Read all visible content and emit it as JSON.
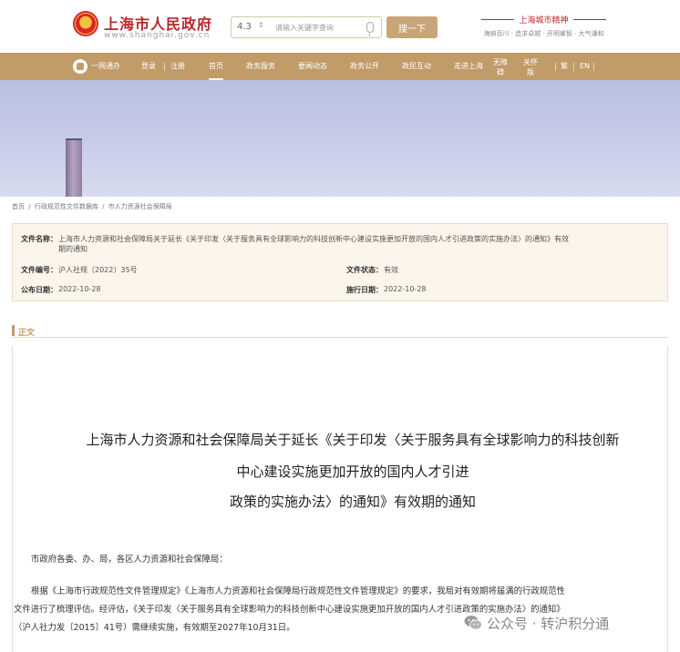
{
  "header": {
    "site_title": "上海市人民政府",
    "site_url": "www.shanghai.gov.cn",
    "search": {
      "scope": "4.3",
      "placeholder": "请输入关键字查询",
      "button_label": "搜一下"
    },
    "city_spirit": {
      "title": "上海城市精神",
      "text": "海纳百川 · 追求卓越 · 开明睿智 · 大气谦和"
    }
  },
  "nav": {
    "items": [
      {
        "label": "一网通办"
      },
      {
        "label": "登录"
      },
      {
        "label": "注册"
      },
      {
        "label": "首页"
      },
      {
        "label": "政务服务"
      },
      {
        "label": "要闻动态"
      },
      {
        "label": "政务公开"
      },
      {
        "label": "政民互动"
      },
      {
        "label": "走进上海"
      },
      {
        "label": "无障碍"
      },
      {
        "label": "关怀版"
      },
      {
        "label": "繁"
      },
      {
        "label": "EN"
      }
    ]
  },
  "breadcrumb": [
    "首页",
    "/",
    "行政规范性文件数据库",
    "/",
    "市人力资源社会保障局"
  ],
  "info": {
    "doc_name_label": "文件名称：",
    "doc_name": "上海市人力资源和社会保障局关于延长《关于印发〈关于服务具有全球影响力的科技创新中心建设实施更加开放的国内人才引进政策的实施办法〉的通知》有效期的通知",
    "doc_no_label": "文件编号：",
    "doc_no": "沪人社规〔2022〕35号",
    "status_label": "文件状态：",
    "status": "有效",
    "publish_label": "公布日期：",
    "publish_date": "2022-10-28",
    "effective_label": "施行日期：",
    "effective_date": "2022-10-28"
  },
  "section_label": "正文",
  "document": {
    "title_lines": [
      "上海市人力资源和社会保障局关于延长《关于印发〈关于服务具有全球影响力的科技创新",
      "中心建设实施更加开放的国内人才引进",
      "政策的实施办法〉的通知》有效期的通知"
    ],
    "salutation": "市政府各委、办、局，各区人力资源和社会保障局：",
    "body_lines": [
      "根据《上海市行政规范性文件管理规定》《上海市人力资源和社会保障局行政规范性文件管理规定》的要求，我局对有效期将届满的行政规范性",
      "文件进行了梳理评估。经评估，《关于印发〈关于服务具有全球影响力的科技创新中心建设实施更加开放的国内人才引进政策的实施办法〉的通知》",
      "（沪人社力发〔2015〕41号）需继续实施，有效期至2027年10月31日。"
    ]
  },
  "watermark": {
    "icon": "wechat-icon",
    "text": "公众号 · 转沪积分通"
  },
  "colors": {
    "brand_red": "#b9272b",
    "nav_gold": "#c19b68",
    "info_bg": "#fbf5eb"
  }
}
